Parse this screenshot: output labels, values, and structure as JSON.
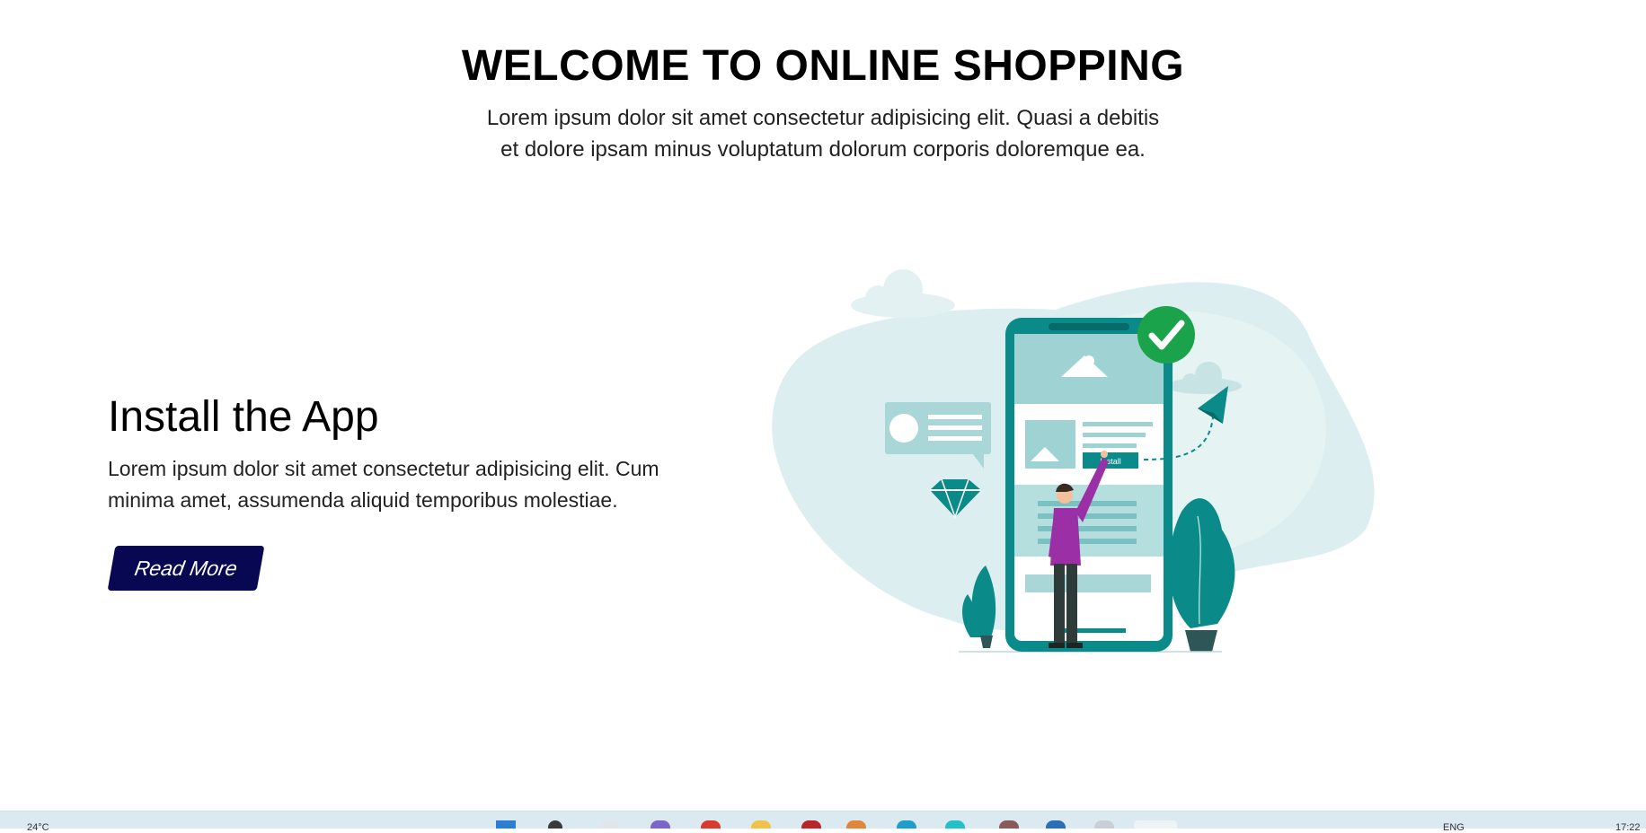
{
  "hero": {
    "title": "WELCOME TO ONLINE SHOPPING",
    "subtitle": "Lorem ipsum dolor sit amet consectetur adipisicing elit. Quasi a debitis et dolore ipsam minus voluptatum dolorum corporis doloremque ea."
  },
  "section": {
    "title": "Install the App",
    "text": "Lorem ipsum dolor sit amet consectetur adipisicing elit. Cum minima amet, assumenda aliquid temporibus molestiae.",
    "button_label": "Read More"
  },
  "illustration": {
    "install_label": "Install"
  },
  "taskbar": {
    "weather": "24°C",
    "language": "ENG",
    "time": "17:22"
  },
  "colors": {
    "accent": "#008b8b",
    "button": "#070752",
    "person_shirt": "#9b2fa5",
    "check": "#1aa34a",
    "blob": "#d6ebec"
  }
}
